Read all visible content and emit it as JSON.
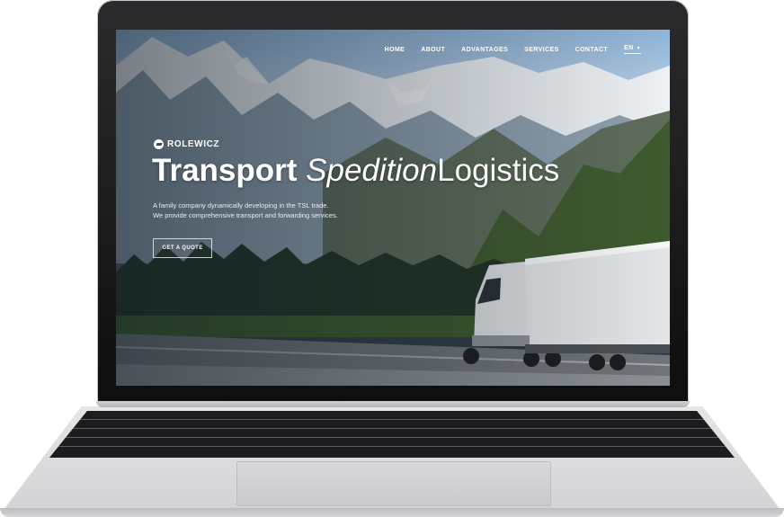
{
  "nav": {
    "items": [
      "HOME",
      "ABOUT",
      "ADVANTAGES",
      "SERVICES",
      "CONTACT"
    ],
    "language": "EN"
  },
  "brand": {
    "name": "ROLEWICZ"
  },
  "hero": {
    "headline_bold": "Transport",
    "headline_italic": "Spedition",
    "headline_light": "Logistics",
    "subtitle_line1": "A family company dynamically developing in the TSL trade.",
    "subtitle_line2": "We provide comprehensive transport and forwarding services.",
    "cta_label": "GET A QUOTE"
  },
  "icons": {
    "brand_mark": "rolewicz-logo-icon",
    "language_chevron": "chevron-down-icon"
  }
}
